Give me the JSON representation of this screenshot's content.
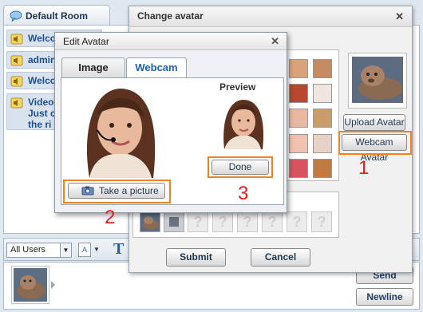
{
  "chat": {
    "room_title": "Default Room",
    "messages": [
      {
        "text": "Welco"
      },
      {
        "text": "admin"
      },
      {
        "text": "Welco"
      },
      {
        "text": "Video\nJust c\nthe ri"
      }
    ],
    "users_filter": "All Users",
    "font_btn": "A",
    "text_btn": "T",
    "send_label": "Send",
    "newline_label": "Newline"
  },
  "change_avatar": {
    "title": "Change avatar",
    "upload_label": "Upload Avatar",
    "webcam_label": "Webcam Avatar",
    "submit_label": "Submit",
    "cancel_label": "Cancel",
    "slot_placeholder": "?"
  },
  "edit_avatar": {
    "title": "Edit Avatar",
    "tabs": [
      {
        "label": "Image",
        "active": false
      },
      {
        "label": "Webcam",
        "active": true
      }
    ],
    "preview_label": "Preview",
    "done_label": "Done",
    "take_picture_label": "Take a picture"
  },
  "annotations": [
    "1",
    "2",
    "3"
  ],
  "colors": {
    "highlight": "#f5821f",
    "annotation": "#e02020",
    "link_blue": "#1e5fb0"
  }
}
